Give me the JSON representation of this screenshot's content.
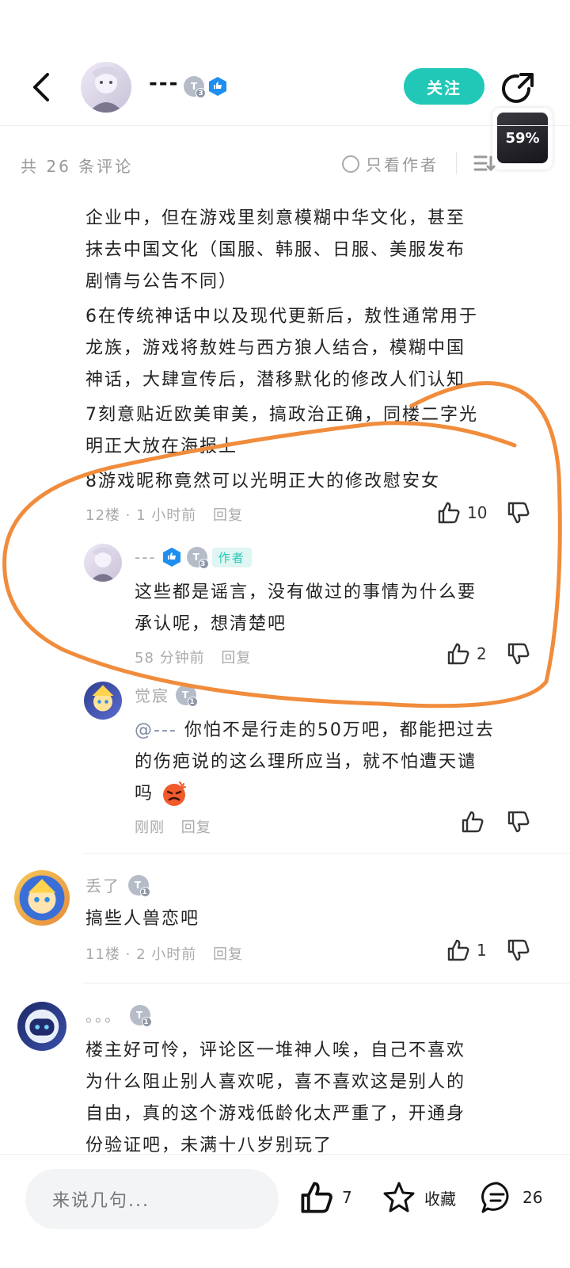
{
  "header": {
    "username": "---",
    "level": "3",
    "follow_label": "关注",
    "float_widget": "59%"
  },
  "filter": {
    "count_label": "共 26 条评论",
    "author_only": "只看作者"
  },
  "main_comment": {
    "lines": [
      "企业中，但在游戏里刻意模糊中华文化，甚至",
      "抹去中国文化（国服、韩服、日服、美服发布",
      "剧情与公告不同）",
      "6在传统神话中以及现代更新后，敖性通常用于",
      "龙族，游戏将敖姓与西方狼人结合，模糊中国",
      "神话，大肆宣传后，潜移默化的修改人们认知",
      "7刻意贴近欧美审美，搞政治正确，同楼二字光",
      "明正大放在海报上",
      "8游戏昵称竟然可以光明正大的修改慰安女"
    ],
    "floor_time": "12楼 · 1 小时前",
    "reply_label": "回复",
    "likes": "10"
  },
  "reply1": {
    "name": "---",
    "level": "3",
    "author_tag": "作者",
    "lines": [
      "这些都是谣言，没有做过的事情为什么要",
      "承认呢，想清楚吧"
    ],
    "time": "58 分钟前",
    "reply_label": "回复",
    "likes": "2"
  },
  "reply2": {
    "name": "觉宸",
    "level": "1",
    "mention": "@---",
    "line1": " 你怕不是行走的50万吧，都能把过去",
    "line2": "的伤疤说的这么理所应当，就不怕遭天谴",
    "line3": "吗",
    "time": "刚刚",
    "reply_label": "回复"
  },
  "comment11": {
    "name": "丢了",
    "level": "1",
    "text": "搞些人兽恋吧",
    "floor_time": "11楼 · 2 小时前",
    "reply_label": "回复",
    "likes": "1"
  },
  "comment_last": {
    "name": "。。。",
    "level": "1",
    "lines": [
      "楼主好可怜，评论区一堆神人唉，自己不喜欢",
      "为什么阻止别人喜欢呢，喜不喜欢这是别人的",
      "自由，真的这个游戏低龄化太严重了，开通身",
      "份验证吧，未满十八岁别玩了"
    ]
  },
  "bottom_bar": {
    "input_placeholder": "来说几句...",
    "likes": "7",
    "favorite_label": "收藏",
    "comments": "26"
  },
  "colors": {
    "accent": "#21c8b7",
    "annotation": "#f08c3c",
    "verify_blue": "#1e8ff0"
  }
}
